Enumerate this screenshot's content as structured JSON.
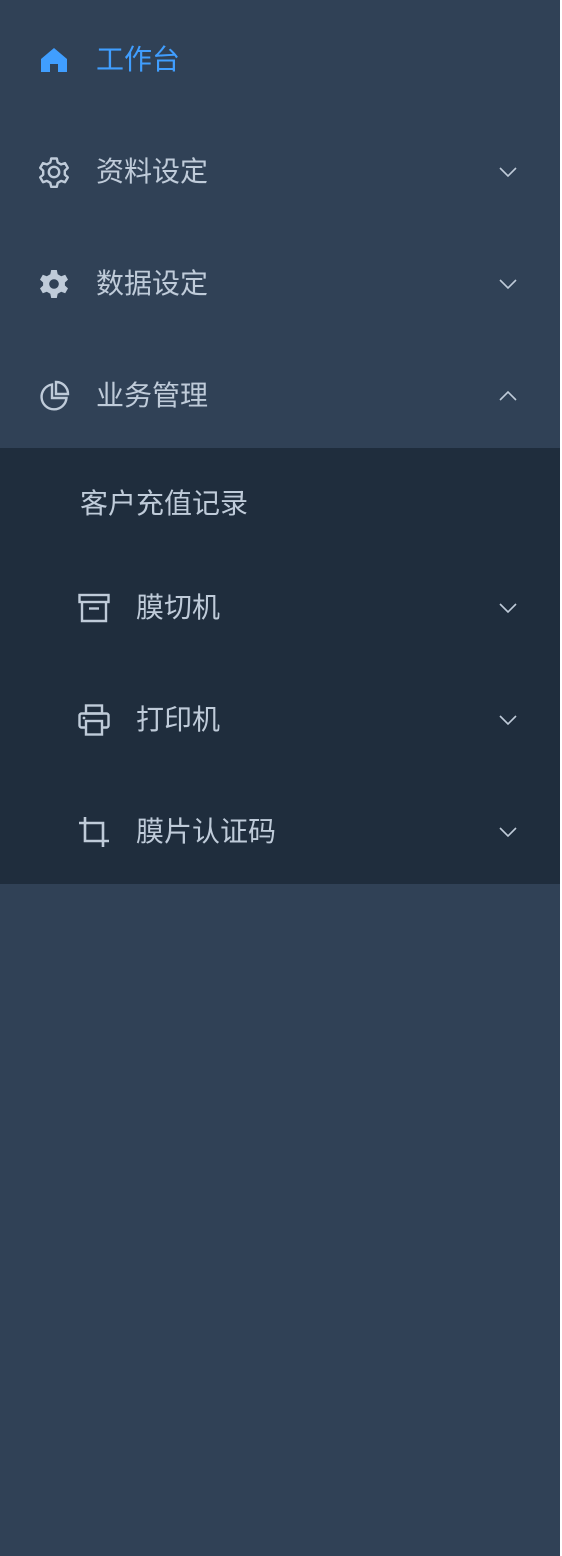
{
  "menu": {
    "items": [
      {
        "label": "工作台",
        "icon": "home-icon",
        "active": true
      },
      {
        "label": "资料设定",
        "icon": "gear-outline-icon",
        "arrow": "chevron-down-icon"
      },
      {
        "label": "数据设定",
        "icon": "gear-solid-icon",
        "arrow": "chevron-down-icon"
      },
      {
        "label": "业务管理",
        "icon": "pie-chart-icon",
        "arrow": "chevron-up-icon",
        "expanded": true
      }
    ],
    "submenu": [
      {
        "label": "客户充值记录"
      },
      {
        "label": "膜切机",
        "icon": "box-icon",
        "arrow": "chevron-down-icon"
      },
      {
        "label": "打印机",
        "icon": "printer-icon",
        "arrow": "chevron-down-icon"
      },
      {
        "label": "膜片认证码",
        "icon": "crop-icon",
        "arrow": "chevron-down-icon"
      }
    ]
  },
  "colors": {
    "sidebar_bg": "#304156",
    "submenu_bg": "#1f2d3d",
    "text": "#bfcbd9",
    "active": "#409eff"
  }
}
